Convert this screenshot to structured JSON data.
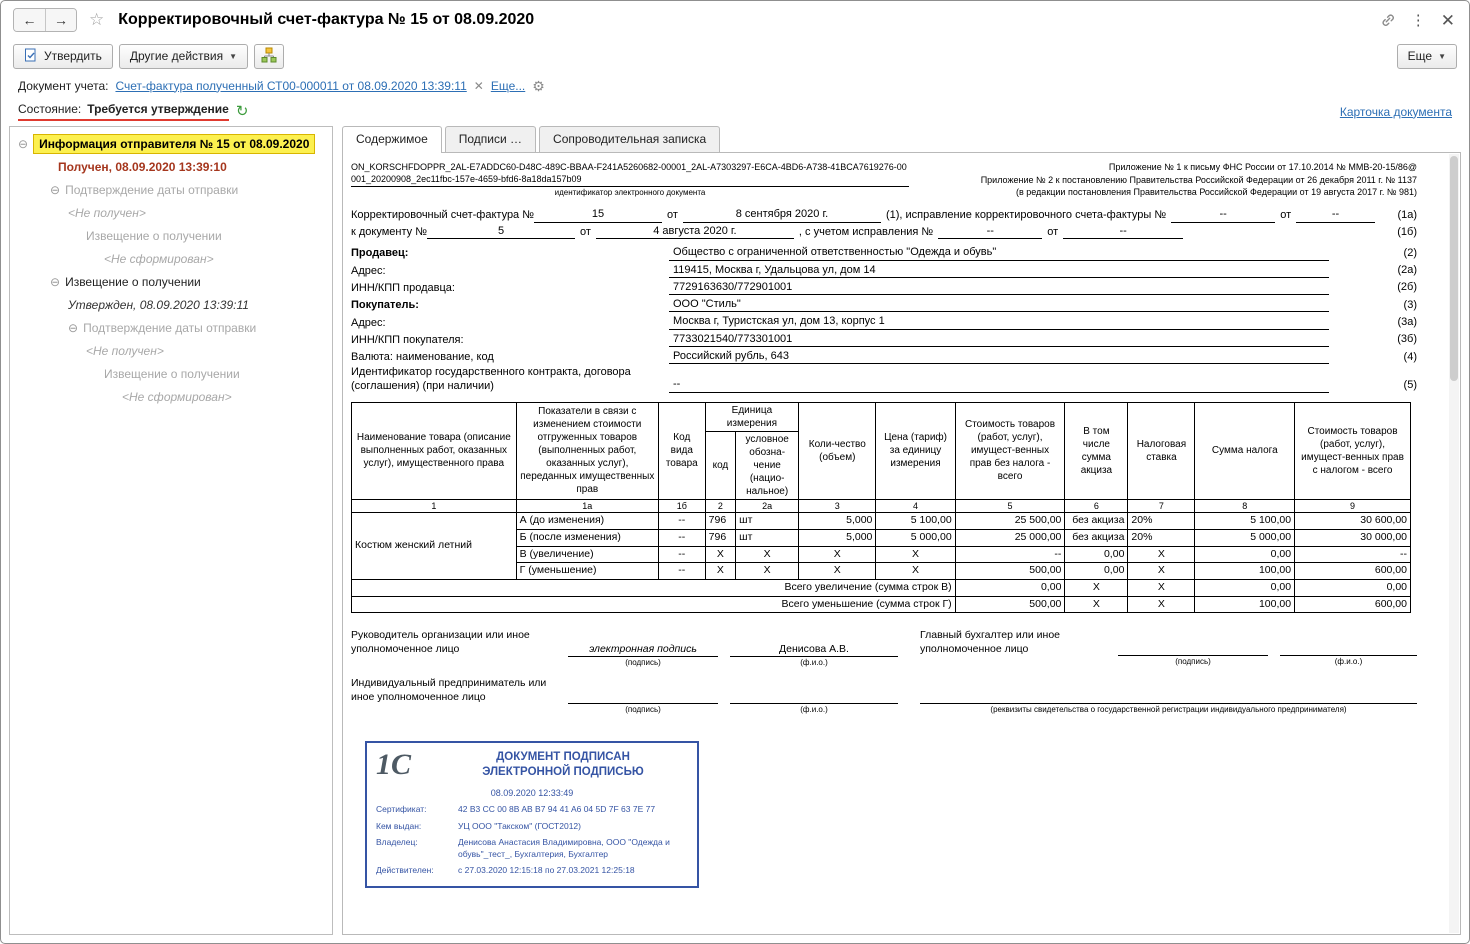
{
  "colors": {
    "selected_item_bg": "#FCF04F",
    "status_underline_red": "#E03A2F",
    "received_status_text": "#A5361D",
    "link_blue": "#2D6FB5",
    "stamp_blue": "#3554A4"
  },
  "header": {
    "title": "Корректировочный счет-фактура № 15 от 08.09.2020"
  },
  "toolbar": {
    "approve": "Утвердить",
    "other_actions": "Другие действия",
    "more": "Еще"
  },
  "accounting_doc": {
    "label": "Документ учета:",
    "link": "Счет-фактура полученный СТ00-000011 от 08.09.2020 13:39:11",
    "more_link": "Еще..."
  },
  "status": {
    "label": "Состояние:",
    "value": "Требуется утверждение",
    "card_link": "Карточка документа"
  },
  "tree": {
    "items": [
      {
        "text": "Информация отправителя № 15 от 08.09.2020"
      },
      {
        "text": "Получен, 08.09.2020 13:39:10"
      },
      {
        "text": "Подтверждение даты отправки"
      },
      {
        "text": "<Не получен>"
      },
      {
        "text": "Извещение о получении"
      },
      {
        "text": "<Не сформирован>"
      },
      {
        "text": "Извещение о получении"
      },
      {
        "text": "Утвержден, 08.09.2020 13:39:11"
      },
      {
        "text": "Подтверждение даты отправки"
      },
      {
        "text": "<Не получен>"
      },
      {
        "text": "Извещение о получении"
      },
      {
        "text": "<Не сформирован>"
      }
    ]
  },
  "tabs": {
    "content": "Содержимое",
    "signatures": "Подписи …",
    "cover_note": "Сопроводительная записка"
  },
  "form": {
    "doc_id": "ON_KORSCHFDOPPR_2AL-E7ADDC60-D48C-489C-BBAA-F241A5260682-00001_2AL-A7303297-E6CA-4BD6-A738-41BCA7619276-00001_20200908_2ec11fbc-157e-4659-bfd6-8a18da157b09",
    "doc_id_caption": "идентификатор электронного документа",
    "annex_lines": [
      "Приложение № 1 к письму ФНС России от 17.10.2014 № ММВ-20-15/86@",
      "Приложение № 2 к постановлению Правительства Российской Федерации от 26 декабря 2011 г. № 1137",
      "(в редакции постановления Правительства Российской Федерации от 19 августа 2017 г. № 981)"
    ],
    "line1": {
      "label": "Корректировочный счет-фактура №",
      "number": "15",
      "ot1": "от",
      "date": "8 сентября 2020 г.",
      "mid": "(1), исправление корректировочного счета-фактуры №",
      "corr_number": "--",
      "ot2": "от",
      "corr_date": "--",
      "note": "(1а)"
    },
    "line2": {
      "label": "к документу №",
      "number": "5",
      "ot1": "от",
      "date": "4 августа 2020 г.",
      "mid": ", с учетом исправления №",
      "fix_number": "--",
      "ot2": "от",
      "fix_date": "--",
      "note": "(1б)"
    },
    "fields": [
      {
        "label": "Продавец:",
        "value": "Общество с ограниченной ответственностью \"Одежда и обувь\"",
        "note": "(2)"
      },
      {
        "label": "Адрес:",
        "value": "119415, Москва г, Удальцова ул, дом 14",
        "note": "(2а)"
      },
      {
        "label": "ИНН/КПП продавца:",
        "value": "7729163630/772901001",
        "note": "(2б)"
      },
      {
        "label": "Покупатель:",
        "value": "ООО \"Стиль\"",
        "note": "(3)"
      },
      {
        "label": "Адрес:",
        "value": "Москва г, Туристская ул, дом 13, корпус 1",
        "note": "(3а)"
      },
      {
        "label": "ИНН/КПП покупателя:",
        "value": "7733021540/773301001",
        "note": "(3б)"
      },
      {
        "label": "Валюта: наименование, код",
        "value": "Российский рубль, 643",
        "note": "(4)"
      },
      {
        "label": "Идентификатор государственного контракта, договора (соглашения) (при наличии)",
        "value": "--",
        "note": "(5)"
      }
    ],
    "table": {
      "headers": {
        "name": "Наименование товара (описание выполненных работ, оказанных услуг), имущественного права",
        "indicators": "Показатели в связи с изменением стоимости отгруженных товаров (выполненных работ, оказанных услуг), переданных имущественных прав",
        "product_code": "Код вида товара",
        "unit_group": "Единица измерения",
        "unit_code": "код",
        "unit_symbol": "условное обозна-чение (нацио-нальное)",
        "quantity": "Коли-чество (объем)",
        "price": "Цена (тариф) за единицу измерения",
        "cost_without_tax": "Стоимость товаров (работ, услуг), имущест-венных прав без налога - всего",
        "excise": "В том числе сумма акциза",
        "tax_rate": "Налоговая ставка",
        "tax_amount": "Сумма налога",
        "cost_with_tax": "Стоимость товаров (работ, услуг), имущест-венных прав с налогом - всего"
      },
      "col_numbers": [
        "1",
        "1а",
        "1б",
        "2",
        "2а",
        "3",
        "4",
        "5",
        "6",
        "7",
        "8",
        "9"
      ],
      "rows": [
        {
          "name": "Костюм женский летний",
          "indicator": "А (до изменения)",
          "cells": [
            "--",
            "796",
            "шт",
            "5,000",
            "5 100,00",
            "25 500,00",
            "без акциза",
            "20%",
            "5 100,00",
            "30 600,00"
          ]
        },
        {
          "indicator": "Б (после изменения)",
          "cells": [
            "--",
            "796",
            "шт",
            "5,000",
            "5 000,00",
            "25 000,00",
            "без акциза",
            "20%",
            "5 000,00",
            "30 000,00"
          ]
        },
        {
          "indicator": "В (увеличение)",
          "cells": [
            "--",
            "X",
            "X",
            "X",
            "X",
            "--",
            "0,00",
            "X",
            "0,00",
            "--"
          ]
        },
        {
          "indicator": "Г (уменьшение)",
          "cells": [
            "--",
            "X",
            "X",
            "X",
            "X",
            "500,00",
            "0,00",
            "X",
            "100,00",
            "600,00"
          ]
        }
      ],
      "totals": [
        {
          "label": "Всего увеличение (сумма строк В)",
          "cells": [
            "0,00",
            "X",
            "X",
            "0,00",
            "0,00"
          ]
        },
        {
          "label": "Всего уменьшение (сумма строк Г)",
          "cells": [
            "500,00",
            "X",
            "X",
            "100,00",
            "600,00"
          ]
        }
      ]
    },
    "signatures": {
      "head_label": "Руководитель организации или иное уполномоченное лицо",
      "head_signature": "электронная подпись",
      "head_name": "Денисова А.В.",
      "accountant_label": "Главный бухгалтер или иное уполномоченное лицо",
      "entrepreneur_label": "Индивидуальный предприниматель или иное уполномоченное лицо",
      "sign_caption": "(подпись)",
      "name_caption": "(ф.и.о.)",
      "reg_caption": "(реквизиты свидетельства о государственной регистрации индивидуального предпринимателя)"
    },
    "stamp": {
      "logo": "1С",
      "title_line1": "ДОКУМЕНТ ПОДПИСАН",
      "title_line2": "ЭЛЕКТРОННОЙ ПОДПИСЬЮ",
      "datetime": "08.09.2020 12:33:49",
      "rows": [
        {
          "label": "Сертификат:",
          "value": "42 B3 CC 00 8B AB B7 94 41 A6 04 5D 7F 63 7E 77"
        },
        {
          "label": "Кем выдан:",
          "value": "УЦ ООО \"Такском\" (ГОСТ2012)"
        },
        {
          "label": "Владелец:",
          "value": "Денисова Анастасия Владимировна, ООО \"Одежда и обувь\"_тест_, Бухгалтерия, Бухгалтер"
        },
        {
          "label": "Действителен:",
          "value": "с 27.03.2020 12:15:18 по 27.03.2021 12:25:18"
        }
      ]
    }
  }
}
